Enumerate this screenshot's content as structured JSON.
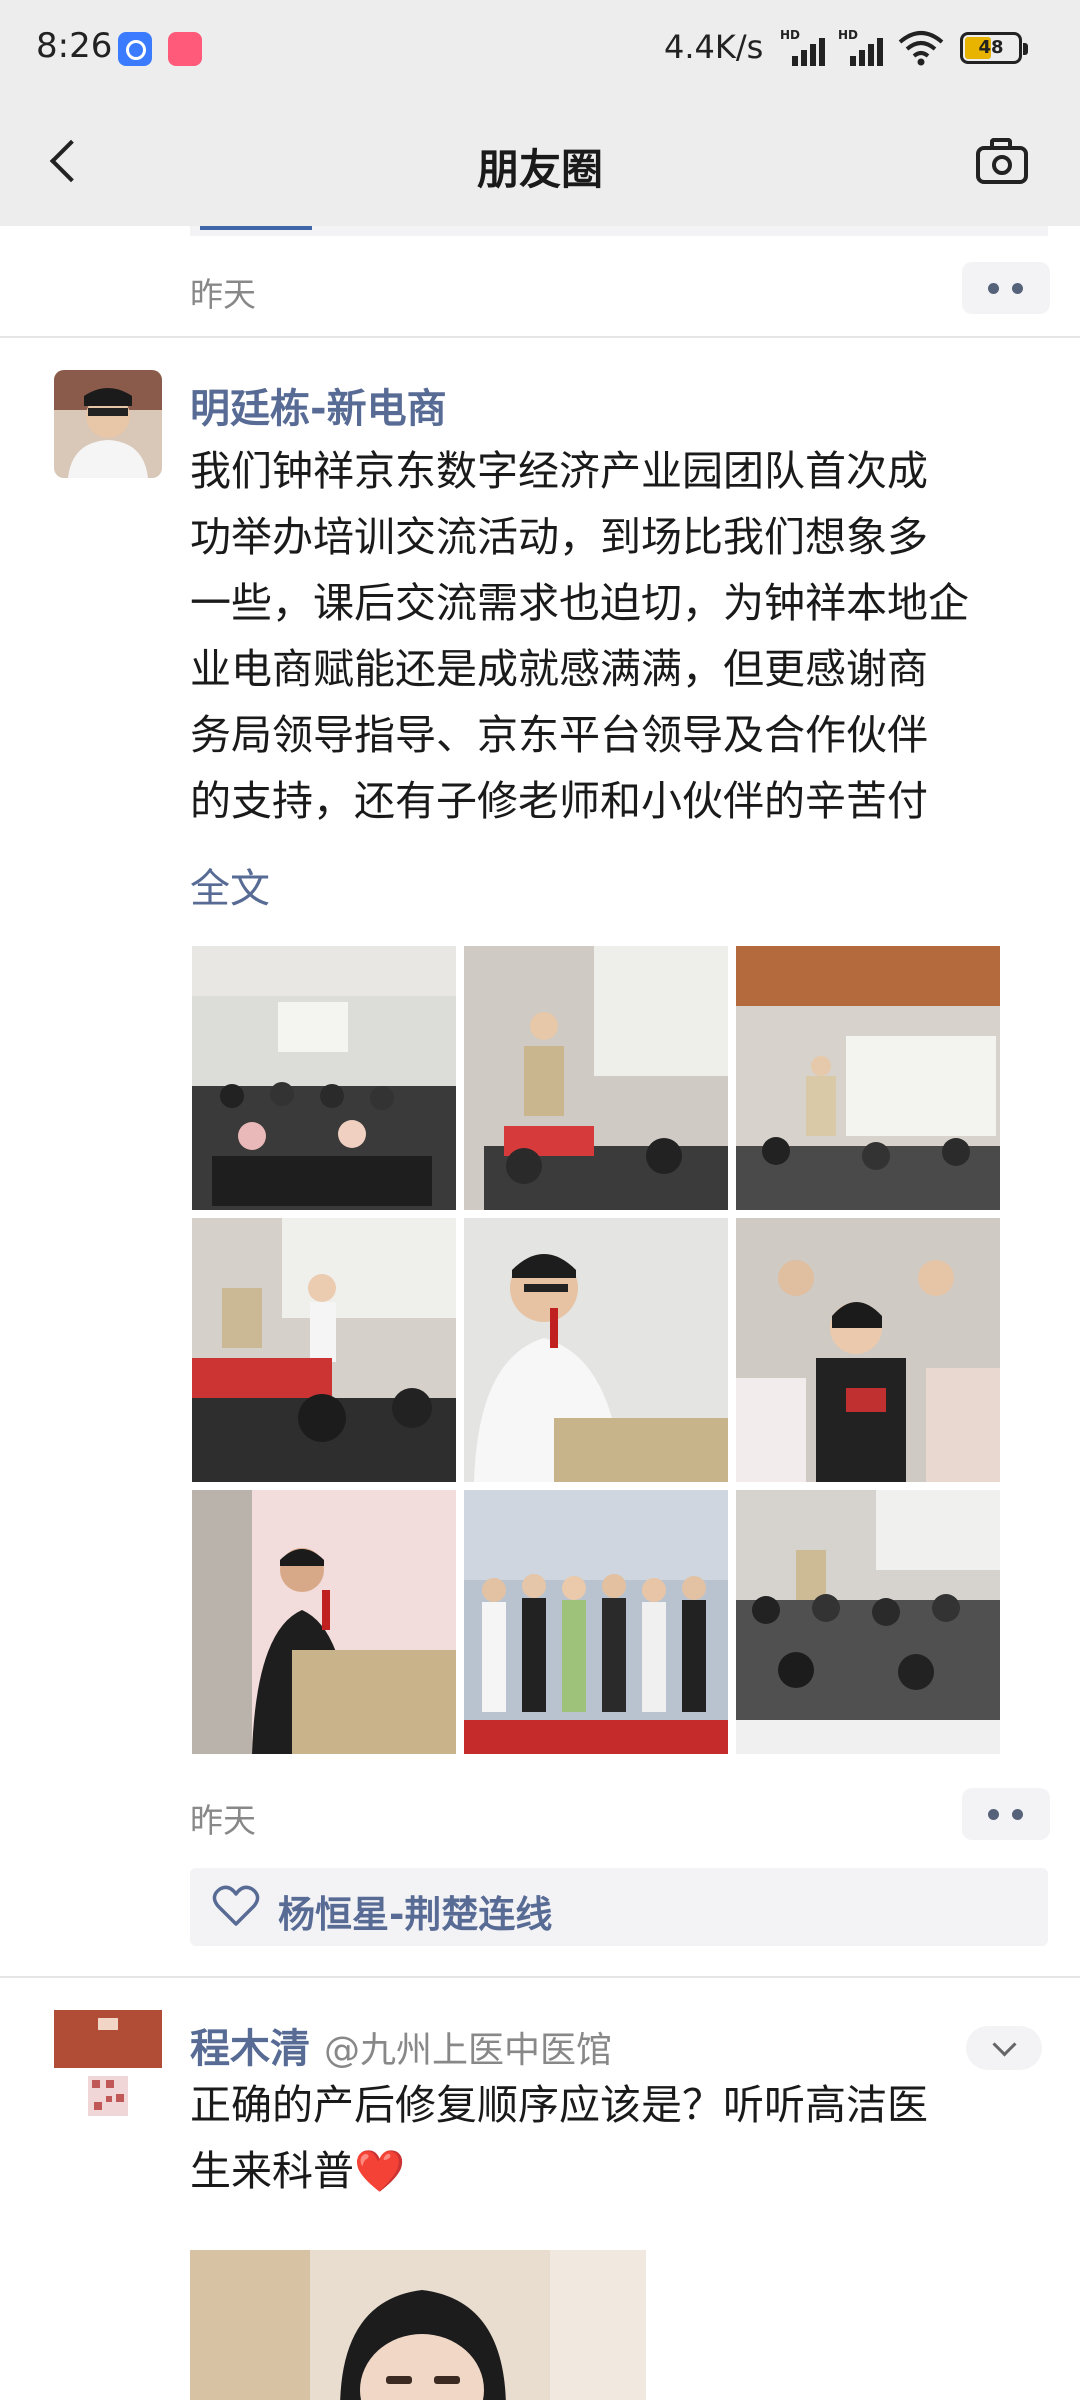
{
  "status_bar": {
    "time": "8:26",
    "net_speed": "4.4K/s",
    "signal_label": "HD",
    "battery": "48"
  },
  "nav": {
    "title": "朋友圈"
  },
  "previous_post": {
    "time": "昨天"
  },
  "post1": {
    "author": "明廷栋-新电商",
    "text": "我们钟祥京东数字经济产业园团队首次成\n功举办培训交流活动，到场比我们想象多\n一些，课后交流需求也迫切，为钟祥本地企\n业电商赋能还是成就感满满，但更感谢商\n务局领导指导、京东平台领导及合作伙伴\n的支持，还有子修老师和小伙伴的辛苦付",
    "expand_label": "全文",
    "time": "昨天",
    "likes": [
      "杨恒星-荆楚连线"
    ]
  },
  "post2": {
    "author": "程木清",
    "handle": "@九州上医中医馆",
    "text": "正确的产后修复顺序应该是？听听高洁医\n生来科普",
    "emoji": "❤️"
  },
  "colors": {
    "link_blue": "#576b95",
    "nav_bg": "#ededed",
    "timestamp_gray": "#888888"
  }
}
